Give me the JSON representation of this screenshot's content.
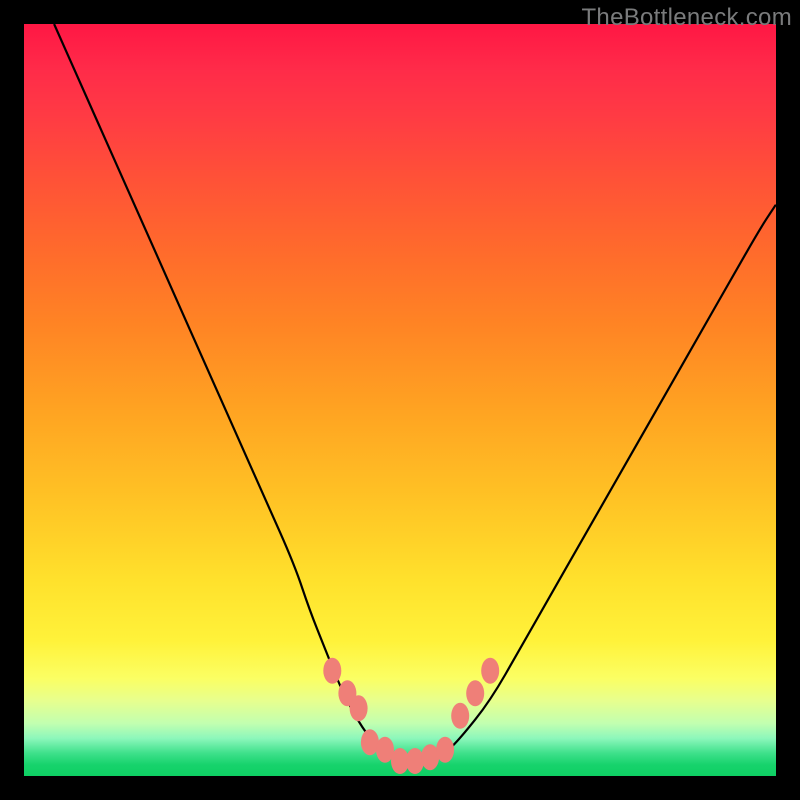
{
  "watermark": "TheBottleneck.com",
  "colors": {
    "frame": "#000000",
    "gradient_top": "#ff1744",
    "gradient_mid": "#ffe12c",
    "gradient_bottom": "#0ecf63",
    "curve": "#000000",
    "bead": "#ef7f78"
  },
  "chart_data": {
    "type": "line",
    "title": "",
    "xlabel": "",
    "ylabel": "",
    "xlim": [
      0,
      100
    ],
    "ylim": [
      0,
      100
    ],
    "series": [
      {
        "name": "bottleneck-curve",
        "x": [
          4,
          8,
          12,
          16,
          20,
          24,
          28,
          32,
          36,
          38,
          40,
          42,
          44,
          46,
          48,
          50,
          52,
          54,
          56,
          58,
          62,
          66,
          70,
          74,
          78,
          82,
          86,
          90,
          94,
          98,
          100
        ],
        "y": [
          100,
          91,
          82,
          73,
          64,
          55,
          46,
          37,
          28,
          22,
          17,
          12,
          8,
          5,
          3,
          2,
          2,
          2,
          3,
          5,
          10,
          17,
          24,
          31,
          38,
          45,
          52,
          59,
          66,
          73,
          76
        ]
      }
    ],
    "markers": [
      {
        "x": 41,
        "y": 14
      },
      {
        "x": 43,
        "y": 11
      },
      {
        "x": 44.5,
        "y": 9
      },
      {
        "x": 46,
        "y": 4.5
      },
      {
        "x": 48,
        "y": 3.5
      },
      {
        "x": 50,
        "y": 2.0
      },
      {
        "x": 52,
        "y": 2.0
      },
      {
        "x": 54,
        "y": 2.5
      },
      {
        "x": 56,
        "y": 3.5
      },
      {
        "x": 58,
        "y": 8
      },
      {
        "x": 60,
        "y": 11
      },
      {
        "x": 62,
        "y": 14
      }
    ],
    "annotations": []
  }
}
